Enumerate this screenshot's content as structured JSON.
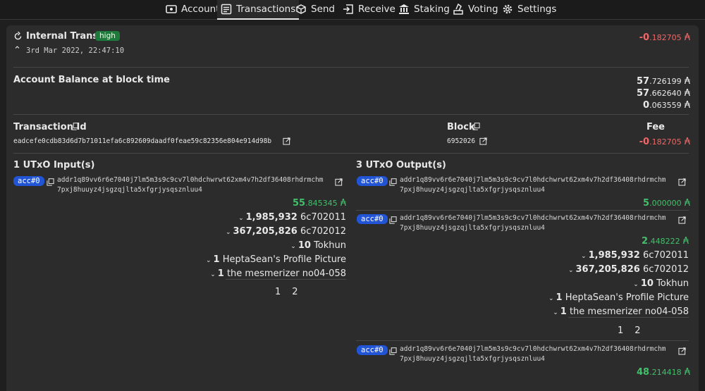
{
  "nav": {
    "tabs": [
      {
        "label": "Account",
        "icon": "wallet-icon"
      },
      {
        "label": "Transactions",
        "icon": "list-icon"
      },
      {
        "label": "Send",
        "icon": "cube-send-icon"
      },
      {
        "label": "Receive",
        "icon": "receive-icon"
      },
      {
        "label": "Staking",
        "icon": "bank-icon"
      },
      {
        "label": "Voting",
        "icon": "ballot-icon"
      },
      {
        "label": "Settings",
        "icon": "gear-icon"
      }
    ],
    "active": "Transactions"
  },
  "tx": {
    "type": "Internal Transfer",
    "badge": "high",
    "datetime": "3rd Mar 2022, 22:47:10",
    "amount_int": "-0",
    "amount_frac": ".182705",
    "currency": "₳",
    "balance_label": "Account Balance at block time",
    "balances": [
      {
        "int": "57",
        "frac": ".726199"
      },
      {
        "int": "57",
        "frac": ".662640"
      },
      {
        "int": "0",
        "frac": ".063559"
      }
    ],
    "id_label": "Transaction Id",
    "id_value": "eadcefe0cdb83d6d7b71011efa6c892609daadf0feae59c82356e804e914d98b",
    "block_label": "Block",
    "block_value": "6952026",
    "fee_label": "Fee",
    "fee_int": "-0",
    "fee_frac": ".182705"
  },
  "inputs": {
    "title": "1 UTxO Input(s)",
    "acc": "acc#0",
    "addr_line1": "addr1q89vv6r6e7040j7lm5m3s9c9cv7l0hdchwrwt62xm4v7h2df36408rhdrmchm",
    "addr_line2": "7pxj8huuyz4jsgzqjlta5xfgrjysqsznluu4",
    "amount_int": "55",
    "amount_frac": ".845345",
    "assets": [
      {
        "qty": "1,985,932",
        "name": "6c702011"
      },
      {
        "qty": "367,205,826",
        "name": "6c702012"
      },
      {
        "qty": "10",
        "name": "Tokhun"
      },
      {
        "qty": "1",
        "name": "HeptaSean's Profile Picture"
      },
      {
        "qty": "1",
        "name": "the mesmerizer no04-058"
      }
    ],
    "pages": [
      "1",
      "2"
    ]
  },
  "outputs": {
    "title": "3 UTxO Output(s)",
    "items": [
      {
        "acc": "acc#0",
        "addr_line1": "addr1q89vv6r6e7040j7lm5m3s9c9cv7l0hdchwrwt62xm4v7h2df36408rhdrmchm",
        "addr_line2": "7pxj8huuyz4jsgzqjlta5xfgrjysqsznluu4",
        "amount_int": "5",
        "amount_frac": ".000000"
      },
      {
        "acc": "acc#0",
        "addr_line1": "addr1q89vv6r6e7040j7lm5m3s9c9cv7l0hdchwrwt62xm4v7h2df36408rhdrmchm",
        "addr_line2": "7pxj8huuyz4jsgzqjlta5xfgrjysqsznluu4",
        "amount_int": "2",
        "amount_frac": ".448222",
        "assets": [
          {
            "qty": "1,985,932",
            "name": "6c702011"
          },
          {
            "qty": "367,205,826",
            "name": "6c702012"
          },
          {
            "qty": "10",
            "name": "Tokhun"
          },
          {
            "qty": "1",
            "name": "HeptaSean's Profile Picture"
          },
          {
            "qty": "1",
            "name": "the mesmerizer no04-058"
          }
        ],
        "pages": [
          "1",
          "2"
        ]
      },
      {
        "acc": "acc#0",
        "addr_line1": "addr1q89vv6r6e7040j7lm5m3s9c9cv7l0hdchwrwt62xm4v7h2df36408rhdrmchm",
        "addr_line2": "7pxj8huuyz4jsgzqjlta5xfgrjysqsznluu4",
        "amount_int": "48",
        "amount_frac": ".214418"
      }
    ]
  },
  "colors": {
    "negative": "#f16666",
    "positive": "#41c06a",
    "badge_high": "#1d7a3b",
    "acc_badge": "#2155d6"
  }
}
